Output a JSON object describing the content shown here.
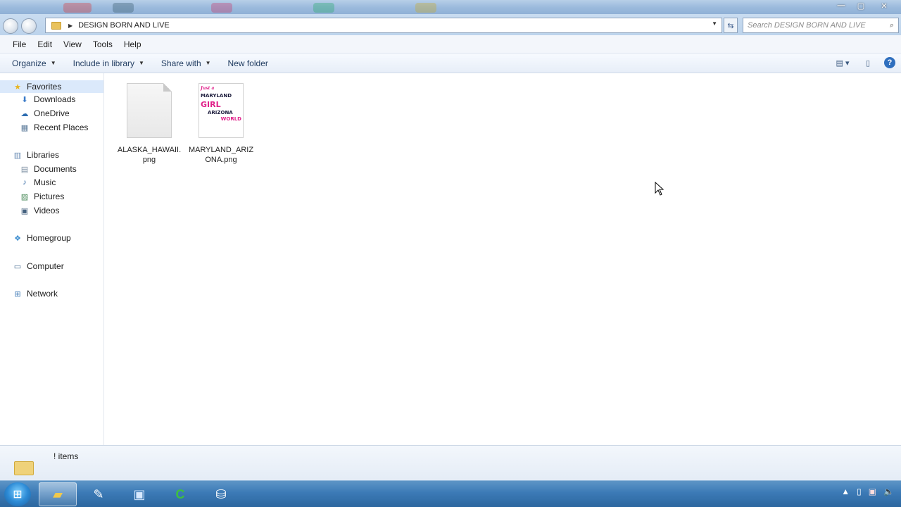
{
  "window": {
    "address_path": "DESIGN BORN AND LIVE",
    "search_placeholder": "Search DESIGN BORN AND LIVE",
    "controls": {
      "minimize": "—",
      "maximize": "▢",
      "close": "✕"
    }
  },
  "menu": [
    "File",
    "Edit",
    "View",
    "Tools",
    "Help"
  ],
  "toolbar": {
    "organize": "Organize",
    "include_in_library": "Include in library",
    "share_with": "Share with",
    "new_folder": "New folder"
  },
  "nav": {
    "favorites": {
      "label": "Favorites",
      "items": [
        "Downloads",
        "OneDrive",
        "Recent Places"
      ]
    },
    "libraries": {
      "label": "Libraries",
      "items": [
        "Documents",
        "Music",
        "Pictures",
        "Videos"
      ]
    },
    "homegroup": "Homegroup",
    "computer": "Computer",
    "network": "Network"
  },
  "files": [
    {
      "name": "ALASKA_HAWAII.png",
      "thumb": "blank"
    },
    {
      "name": "MARYLAND_ARIZONA.png",
      "thumb": "art",
      "art_text": [
        "Just a",
        "MARYLAND",
        "GIRL",
        "ARIZONA",
        "WORLD"
      ]
    }
  ],
  "status": {
    "item_count": "! items"
  },
  "colors": {
    "accent_pink": "#e0218a",
    "navy_text": "#1a1a3a"
  },
  "taskbar": {
    "start_icon": "windows-logo-icon",
    "apps": [
      "explorer-icon",
      "notepad-icon",
      "remote-desktop-icon",
      "camtasia-icon",
      "store-icon"
    ]
  }
}
